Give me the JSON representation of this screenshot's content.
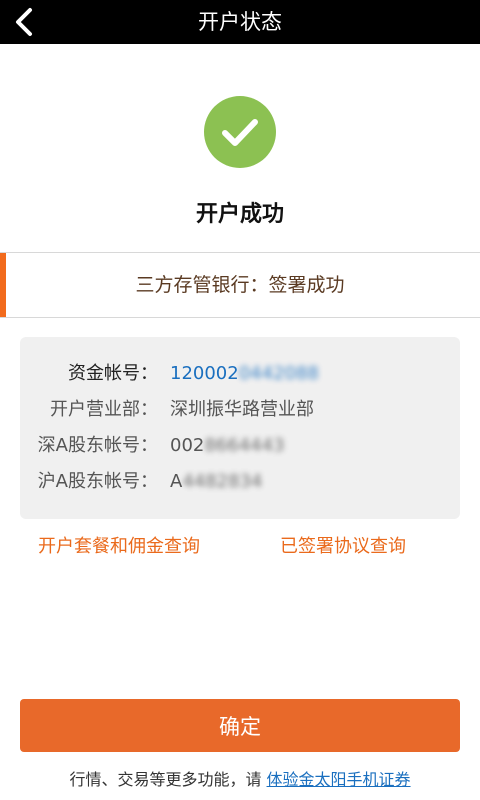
{
  "header": {
    "title": "开户状态",
    "back_icon": "chevron-left-icon"
  },
  "status": {
    "icon": "check-circle-icon",
    "icon_color": "#8cc152",
    "title": "开户成功"
  },
  "bank": {
    "text": "三方存管银行：签署成功",
    "accent_color": "#f26b1d"
  },
  "account_info": {
    "fund_account": {
      "label": "资金帐号：",
      "value_visible": "120002",
      "value_masked": "0442088"
    },
    "branch": {
      "label": "开户营业部：",
      "value": "深圳振华路营业部"
    },
    "sz_a_account": {
      "label": "深A股东帐号：",
      "value_visible": "002",
      "value_masked": "8664443"
    },
    "sh_a_account": {
      "label": "沪A股东帐号：",
      "value_visible": "A",
      "value_masked": "4482834"
    }
  },
  "links": {
    "package_query": "开户套餐和佣金查询",
    "agreement_query": "已签署协议查询"
  },
  "confirm_button": {
    "label": "确定",
    "color": "#e8692a"
  },
  "footer": {
    "text": "行情、交易等更多功能，请 ",
    "link_text": "体验金太阳手机证券"
  }
}
